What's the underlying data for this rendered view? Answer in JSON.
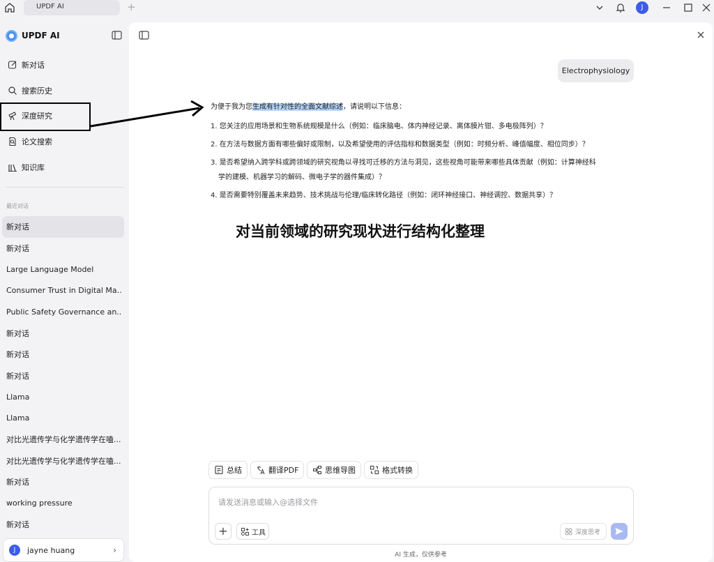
{
  "titlebar": {
    "tab_label": "UPDF AI",
    "new_tab": "+",
    "avatar_letter": "J"
  },
  "sidebar": {
    "brand": "UPDF AI",
    "nav": [
      {
        "label": "新对话",
        "icon": "edit-icon"
      },
      {
        "label": "搜索历史",
        "icon": "search-icon"
      },
      {
        "label": "深度研究",
        "icon": "telescope-icon"
      },
      {
        "label": "论文搜索",
        "icon": "paper-search-icon"
      },
      {
        "label": "知识库",
        "icon": "library-icon"
      }
    ],
    "recent_heading": "最近对话",
    "history": [
      "新对话",
      "新对话",
      "Large Language Model",
      "Consumer Trust in Digital Ma...",
      "Public Safety Governance an...",
      "新对话",
      "新对话",
      "新对话",
      "Llama",
      "Llama",
      "对比光遗传学与化学遗传学在嗑...",
      "对比光遗传学与化学遗传学在嗑...",
      "新对话",
      "working pressure",
      "新对话"
    ],
    "user": {
      "avatar_letter": "J",
      "name": "jayne huang",
      "chevron": "›"
    }
  },
  "chat": {
    "user_message": "Electrophysiology",
    "answer": {
      "intro_before": "为便于我为您",
      "intro_highlight": "生成有针对性的全面文献综述",
      "intro_after": "，请说明以下信息：",
      "questions": [
        {
          "n": "1.",
          "text": "您关注的应用场景和生物系统规模是什么（例如：临床脑电、体内神经记录、离体膜片钳、多电极阵列）？",
          "cont": ""
        },
        {
          "n": "2.",
          "text": "在方法与数据方面有哪些偏好或限制，以及希望使用的评估指标和数据类型（例如：时频分析、峰值幅度、相位同步）？",
          "cont": ""
        },
        {
          "n": "3.",
          "text": "是否希望纳入跨学科或跨领域的研究视角以寻找可迁移的方法与洞见，这些视角可能带来哪些具体贡献（例如：计算神经科",
          "cont": "学的建模、机器学习的解码、微电子学的器件集成）？"
        },
        {
          "n": "4.",
          "text": "是否需要特别覆盖未来趋势、技术挑战与伦理/临床转化路径（例如：闭环神经接口、神经调控、数据共享）？",
          "cont": ""
        }
      ]
    },
    "overlay_heading": "对当前领域的研究现状进行结构化整理"
  },
  "quick_actions": [
    {
      "label": "总结",
      "icon": "summary-icon"
    },
    {
      "label": "翻译PDF",
      "icon": "translate-icon"
    },
    {
      "label": "思维导图",
      "icon": "mindmap-icon"
    },
    {
      "label": "格式转换",
      "icon": "convert-icon"
    }
  ],
  "composer": {
    "placeholder": "请发送消息或输入@选择文件",
    "plus": "+",
    "tools_label": "工具",
    "deep_think_label": "深度思考"
  },
  "footnote": "AI 生成，仅供参考",
  "colors": {
    "accent": "#3d5de8",
    "highlight": "#b6d4f9",
    "send_disabled": "#a9b9f4"
  }
}
